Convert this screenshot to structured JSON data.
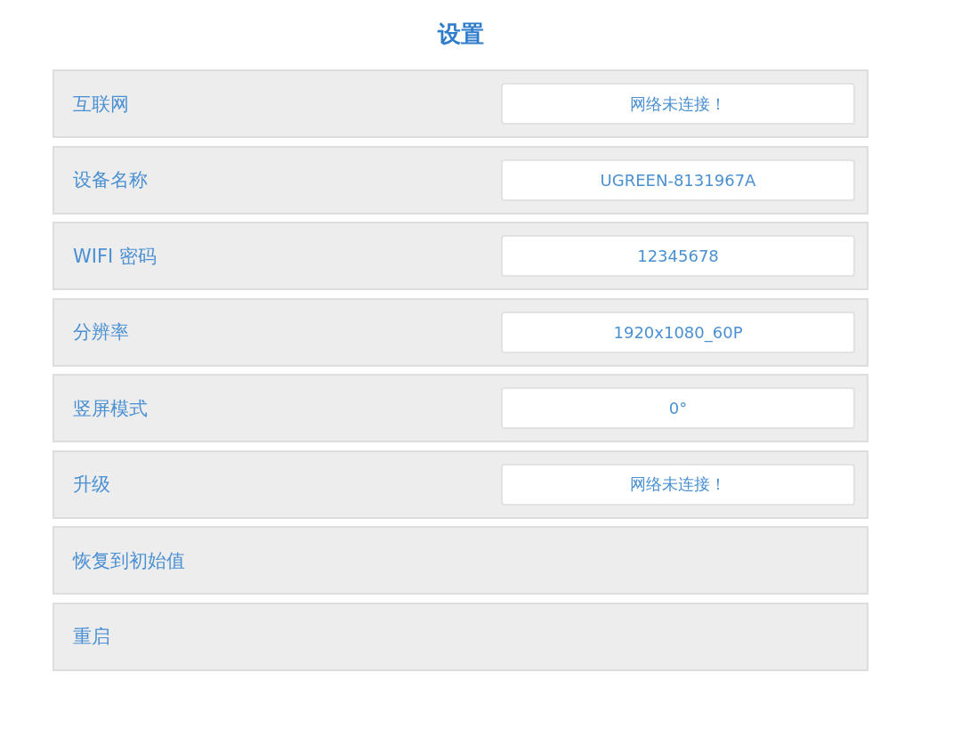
{
  "title": "设置",
  "settings": [
    {
      "kind": "value",
      "label": "互联网",
      "value": "网络未连接！"
    },
    {
      "kind": "value",
      "label": "设备名称",
      "value": "UGREEN-8131967A"
    },
    {
      "kind": "value",
      "label": "WIFI 密码",
      "value": "12345678"
    },
    {
      "kind": "value",
      "label": "分辨率",
      "value": "1920x1080_60P"
    },
    {
      "kind": "value",
      "label": "竖屏模式",
      "value": "0°"
    },
    {
      "kind": "value",
      "label": "升级",
      "value": "网络未连接！"
    },
    {
      "kind": "action",
      "label": "恢复到初始值"
    },
    {
      "kind": "action",
      "label": "重启"
    }
  ]
}
